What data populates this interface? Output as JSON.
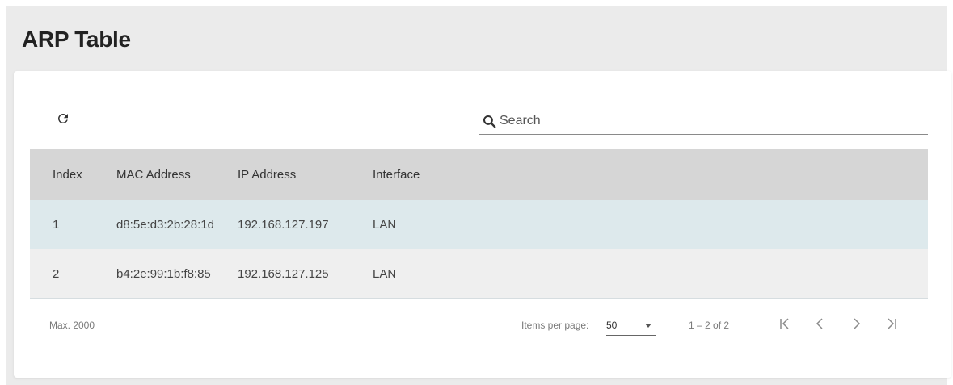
{
  "page": {
    "title": "ARP Table"
  },
  "toolbar": {
    "refresh_icon": "refresh-icon",
    "search_icon": "search-icon",
    "search_placeholder": "Search",
    "search_value": ""
  },
  "table": {
    "columns": [
      "Index",
      "MAC Address",
      "IP Address",
      "Interface"
    ],
    "rows": [
      {
        "index": "1",
        "mac": "d8:5e:d3:2b:28:1d",
        "ip": "192.168.127.197",
        "interface": "LAN"
      },
      {
        "index": "2",
        "mac": "b4:2e:99:1b:f8:85",
        "ip": "192.168.127.125",
        "interface": "LAN"
      }
    ]
  },
  "footer": {
    "max_label": "Max. 2000",
    "items_per_page_label": "Items per page:",
    "items_per_page_value": "50",
    "range_label": "1 – 2 of 2",
    "first_icon": "first-page-icon",
    "prev_icon": "previous-page-icon",
    "next_icon": "next-page-icon",
    "last_icon": "last-page-icon"
  },
  "colors": {
    "page_bg": "#ebebeb",
    "card_bg": "#ffffff",
    "header_bg": "#d6d6d6",
    "selected_row_bg": "#dde9ec",
    "row_bg": "#efefef"
  }
}
